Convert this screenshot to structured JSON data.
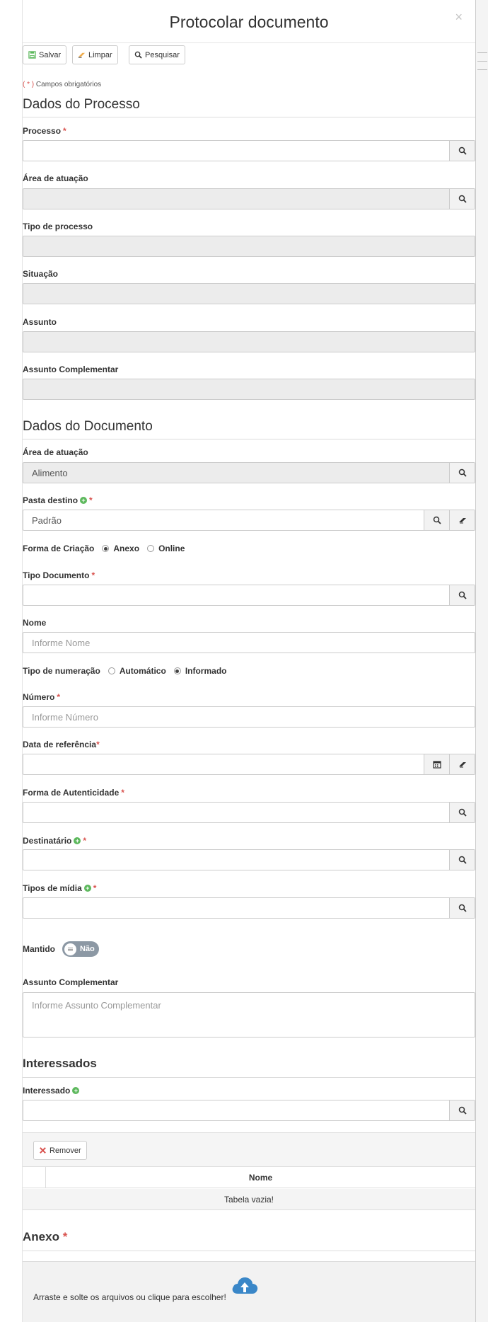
{
  "modal": {
    "title": "Protocolar documento",
    "close": "×"
  },
  "toolbar": {
    "save": "Salvar",
    "clear": "Limpar",
    "search": "Pesquisar"
  },
  "required_note": {
    "open": "(",
    "star": " * ",
    "close": ")",
    "text": " Campos obrigatórios"
  },
  "required_star": "*",
  "process_section": {
    "title": "Dados do Processo",
    "process_label": "Processo",
    "area_label": "Área de atuação",
    "type_label": "Tipo de processo",
    "situation_label": "Situação",
    "subject_label": "Assunto",
    "complement_label": "Assunto Complementar"
  },
  "document_section": {
    "title": "Dados do Documento",
    "area_label": "Área de atuação",
    "area_value": "Alimento",
    "folder_label": "Pasta destino",
    "folder_value": "Padrão",
    "creation_label": "Forma de Criação",
    "creation_options": [
      "Anexo",
      "Online"
    ],
    "creation_selected": "Anexo",
    "doc_type_label": "Tipo Documento",
    "name_label": "Nome",
    "name_placeholder": "Informe Nome",
    "numbering_label": "Tipo de numeração",
    "numbering_options": [
      "Automático",
      "Informado"
    ],
    "numbering_selected": "Informado",
    "number_label": "Número",
    "number_placeholder": "Informe Número",
    "ref_date_label": "Data de referência",
    "auth_label": "Forma de Autenticidade",
    "recipient_label": "Destinatário",
    "media_label": "Tipos de mídia",
    "kept_label": "Mantido",
    "kept_toggle": "Não",
    "complement_label": "Assunto Complementar",
    "complement_placeholder": "Informe Assunto Complementar"
  },
  "interested_section": {
    "title": "Interessados",
    "interested_label": "Interessado",
    "remove_button": "Remover",
    "column_name": "Nome",
    "empty_text": "Tabela vazia!"
  },
  "attachment_section": {
    "title": "Anexo",
    "dropzone_text": "Arraste e solte os arquivos ou clique para escolher!"
  },
  "colors": {
    "required": "#d9534f",
    "add": "#5cb85c",
    "upload": "#3a87c8",
    "remove": "#d9534f"
  },
  "icons": [
    "save-icon",
    "eraser-icon",
    "search-icon",
    "calendar-icon",
    "plus-circle-icon",
    "remove-icon",
    "cloud-upload-icon"
  ]
}
